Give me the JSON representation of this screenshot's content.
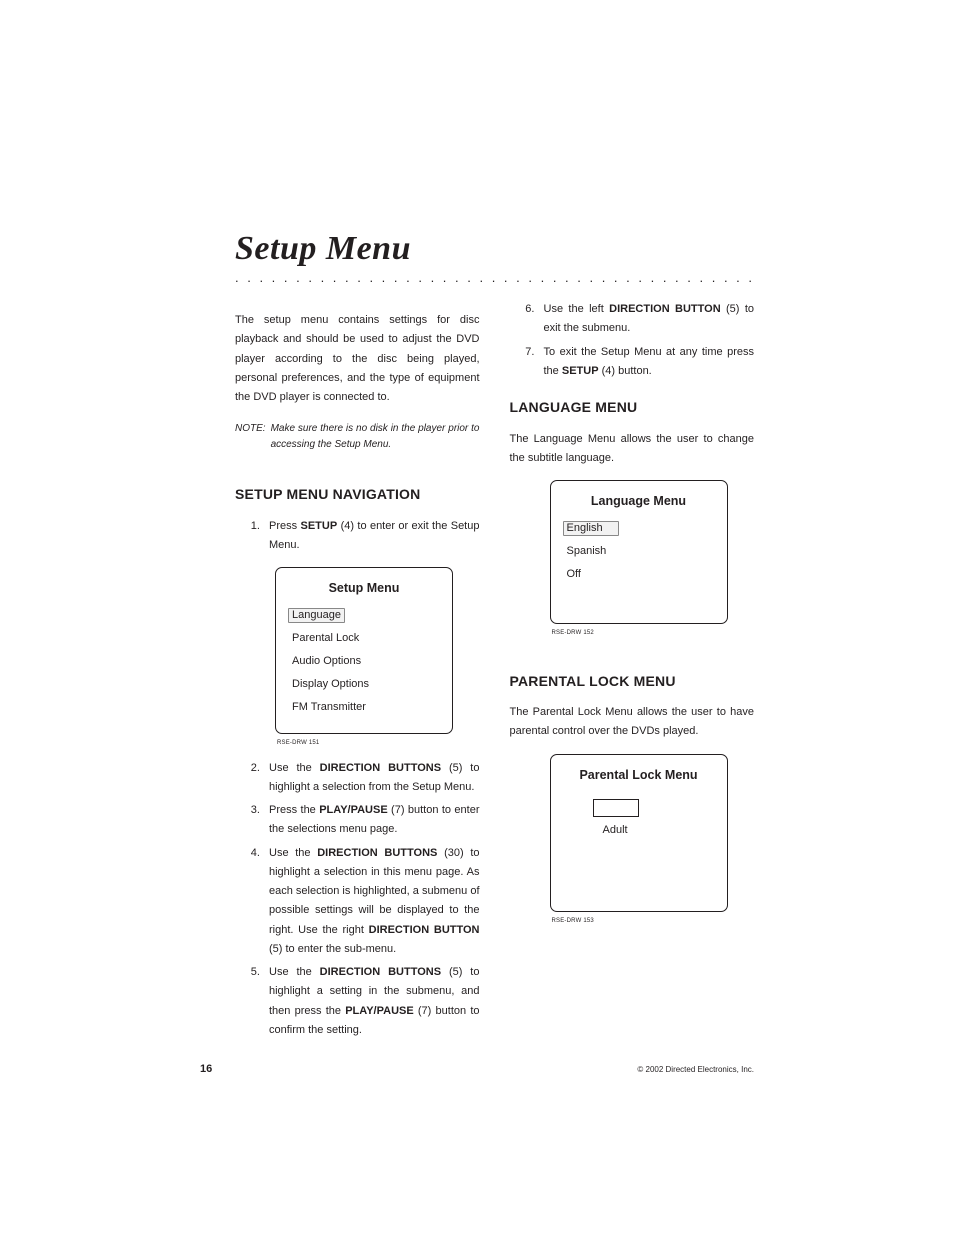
{
  "title": "Setup Menu",
  "dots": ". . . . . . . . . . . . . . . . . . . . . . . . . . . . . . . . . . . . . . . . . . . . . . . . . . . . . . . . . . . . . . . . . . . . . . . . . . . . . . . . . . . . . . . .",
  "intro": "The setup menu contains settings for disc playback and should be used to adjust the DVD player according to the disc being played, personal preferences, and the type of equipment the DVD player is connected to.",
  "note_label": "NOTE:",
  "note_text": "Make sure there is no disk in the player prior to accessing the Setup Menu.",
  "nav_heading": "SETUP MENU NAVIGATION",
  "steps": {
    "s1_a": "Press ",
    "s1_b": "SETUP",
    "s1_c": " (4) to enter or exit the Setup Menu.",
    "s2_a": "Use the ",
    "s2_b": "DIRECTION BUTTONS",
    "s2_c": " (5) to highlight a selection from the Setup Menu.",
    "s3_a": "Press the ",
    "s3_b": "PLAY/PAUSE",
    "s3_c": " (7) button to enter the selections menu page.",
    "s4_a": "Use the ",
    "s4_b": "DIRECTION BUTTONS",
    "s4_c": " (30) to highlight a selection in this menu page. As each selection is highlighted, a submenu of possible settings will be displayed to the right. Use the right ",
    "s4_d": "DIRECTION BUTTON",
    "s4_e": " (5) to enter the sub-menu.",
    "s5_a": "Use the ",
    "s5_b": "DIRECTION BUTTONS",
    "s5_c": " (5) to highlight a setting in the submenu, and then press the ",
    "s5_d": "PLAY/PAUSE",
    "s5_e": " (7) button to confirm the setting.",
    "s6_a": "Use the left ",
    "s6_b": "DIRECTION BUTTON",
    "s6_c": " (5) to exit the submenu.",
    "s7_a": "To exit the Setup Menu at any time press the ",
    "s7_b": "SETUP",
    "s7_c": " (4) button."
  },
  "setup_box": {
    "title": "Setup Menu",
    "items": [
      "Language",
      "Parental Lock",
      "Audio Options",
      "Display Options",
      "FM Transmitter"
    ],
    "selected_index": 0,
    "caption": "RSE-DRW 151"
  },
  "lang_heading": "LANGUAGE MENU",
  "lang_intro": "The Language Menu allows the user to change the subtitle language.",
  "lang_box": {
    "title": "Language Menu",
    "items": [
      "English",
      "Spanish",
      "Off"
    ],
    "selected_index": 0,
    "caption": "RSE-DRW 152"
  },
  "parental_heading": "PARENTAL LOCK MENU",
  "parental_intro": "The Parental Lock Menu allows the user to have parental control over the DVDs played.",
  "parental_box": {
    "title": "Parental Lock Menu",
    "label": "Adult",
    "caption": "RSE-DRW 153"
  },
  "page_number": "16",
  "copyright": "© 2002 Directed Electronics, Inc."
}
